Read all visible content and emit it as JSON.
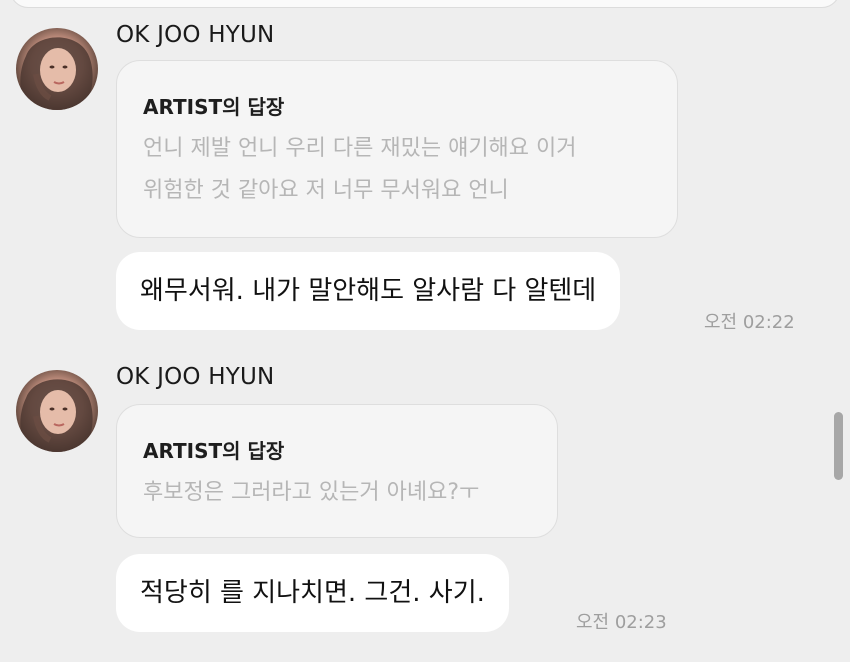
{
  "messages": [
    {
      "sender": "OK JOO HYUN",
      "reply_label": "ARTIST의 답장",
      "quoted_lines": [
        "언니 제발 언니 우리 다른 재밌는 얘기해요 이거",
        "위험한 것 같아요 저 너무 무서워요 언니"
      ],
      "text": "왜무서워.  내가 말안해도 알사람 다 알텐데",
      "time": "오전 02:22"
    },
    {
      "sender": "OK JOO HYUN",
      "reply_label": "ARTIST의 답장",
      "quoted_lines": [
        "후보정은 그러라고 있는거 아녜요?ㅜ"
      ],
      "text": "적당히 를 지나치면. 그건. 사기.",
      "time": "오전 02:23"
    }
  ],
  "icons": {
    "avatar": "avatar-photo"
  },
  "colors": {
    "background": "#eeeeee",
    "bubble": "#ffffff",
    "reply_card": "#f5f5f5",
    "quoted_text": "#b6b6b6",
    "time_text": "#9e9e9e"
  }
}
